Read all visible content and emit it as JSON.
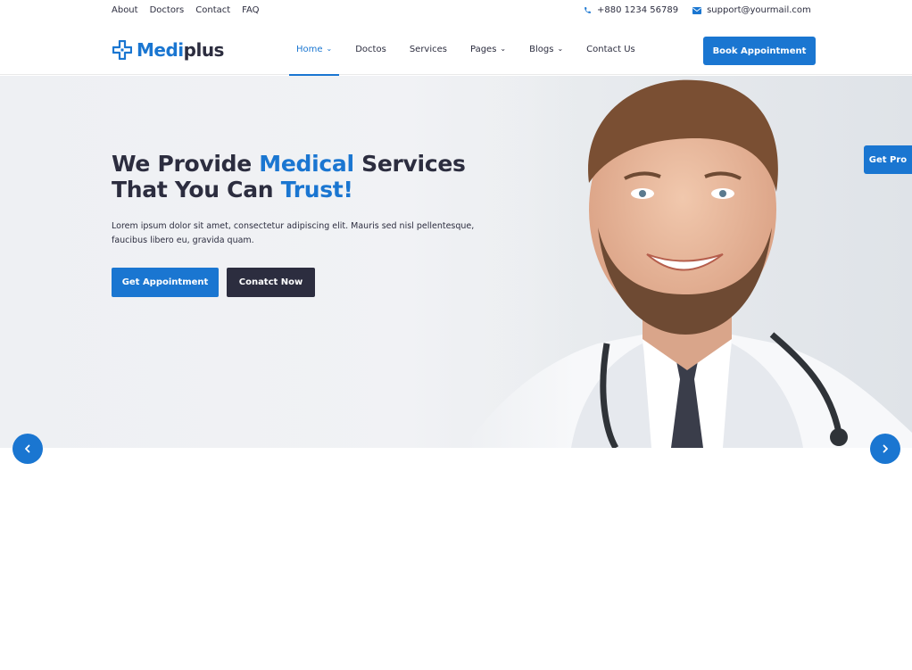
{
  "topbar": {
    "links": [
      "About",
      "Doctors",
      "Contact",
      "FAQ"
    ],
    "phone": "+880 1234 56789",
    "email": "support@yourmail.com"
  },
  "header": {
    "logo": {
      "part1": "Medi",
      "part2": "plus"
    },
    "nav": [
      {
        "label": "Home",
        "has_dropdown": true,
        "active": true
      },
      {
        "label": "Doctos",
        "has_dropdown": false
      },
      {
        "label": "Services",
        "has_dropdown": false
      },
      {
        "label": "Pages",
        "has_dropdown": true
      },
      {
        "label": "Blogs",
        "has_dropdown": true
      },
      {
        "label": "Contact Us",
        "has_dropdown": false
      }
    ],
    "cta": "Book Appointment"
  },
  "hero": {
    "title_line1": {
      "a": "We Provide ",
      "b": "Medical",
      "c": " Services"
    },
    "title_line2": {
      "a": "That You Can ",
      "b": "Trust!"
    },
    "description": "Lorem ipsum dolor sit amet, consectetur adipiscing elit. Mauris sed nisl pellentesque, faucibus libero eu, gravida quam.",
    "primary_button": "Get Appointment",
    "secondary_button": "Conatct Now"
  },
  "side": {
    "get_pro": "Get Pro"
  },
  "icons": {
    "phone": "phone-icon",
    "email": "envelope-icon",
    "prev": "chevron-left-icon",
    "next": "chevron-right-icon"
  },
  "colors": {
    "accent": "#1a76d1",
    "dark": "#2c2d3f"
  }
}
